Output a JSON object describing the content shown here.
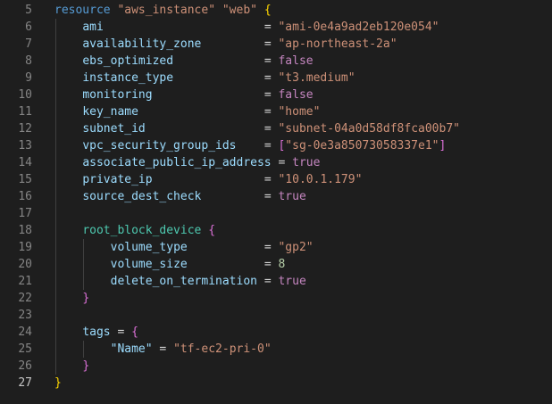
{
  "editor": {
    "lines": [
      {
        "n": "5",
        "indent": 0,
        "parts": [
          [
            "kw",
            "resource"
          ],
          [
            "punc",
            " "
          ],
          [
            "str",
            "\"aws_instance\""
          ],
          [
            "punc",
            " "
          ],
          [
            "str",
            "\"web\""
          ],
          [
            "punc",
            " "
          ],
          [
            "brace-y",
            "{"
          ]
        ]
      },
      {
        "n": "6",
        "indent": 1,
        "parts": [
          [
            "attr",
            "ami"
          ],
          [
            "pad",
            23
          ],
          [
            "eq",
            "= "
          ],
          [
            "str",
            "\"ami-0e4a9ad2eb120e054\""
          ]
        ]
      },
      {
        "n": "7",
        "indent": 1,
        "parts": [
          [
            "attr",
            "availability_zone"
          ],
          [
            "pad",
            9
          ],
          [
            "eq",
            "= "
          ],
          [
            "str",
            "\"ap-northeast-2a\""
          ]
        ]
      },
      {
        "n": "8",
        "indent": 1,
        "parts": [
          [
            "attr",
            "ebs_optimized"
          ],
          [
            "pad",
            13
          ],
          [
            "eq",
            "= "
          ],
          [
            "bool",
            "false"
          ]
        ]
      },
      {
        "n": "9",
        "indent": 1,
        "parts": [
          [
            "attr",
            "instance_type"
          ],
          [
            "pad",
            13
          ],
          [
            "eq",
            "= "
          ],
          [
            "str",
            "\"t3.medium\""
          ]
        ]
      },
      {
        "n": "10",
        "indent": 1,
        "parts": [
          [
            "attr",
            "monitoring"
          ],
          [
            "pad",
            16
          ],
          [
            "eq",
            "= "
          ],
          [
            "bool",
            "false"
          ]
        ]
      },
      {
        "n": "11",
        "indent": 1,
        "parts": [
          [
            "attr",
            "key_name"
          ],
          [
            "pad",
            18
          ],
          [
            "eq",
            "= "
          ],
          [
            "str",
            "\"home\""
          ]
        ]
      },
      {
        "n": "12",
        "indent": 1,
        "parts": [
          [
            "attr",
            "subnet_id"
          ],
          [
            "pad",
            17
          ],
          [
            "eq",
            "= "
          ],
          [
            "str",
            "\"subnet-04a0d58df8fca00b7\""
          ]
        ]
      },
      {
        "n": "13",
        "indent": 1,
        "parts": [
          [
            "attr",
            "vpc_security_group_ids"
          ],
          [
            "pad",
            4
          ],
          [
            "eq",
            "= "
          ],
          [
            "brace-p",
            "["
          ],
          [
            "str",
            "\"sg-0e3a85073058337e1\""
          ],
          [
            "brace-p",
            "]"
          ]
        ]
      },
      {
        "n": "14",
        "indent": 1,
        "parts": [
          [
            "attr",
            "associate_public_ip_address"
          ],
          [
            "pad",
            0
          ],
          [
            "eq",
            " = "
          ],
          [
            "bool",
            "true"
          ]
        ]
      },
      {
        "n": "15",
        "indent": 1,
        "parts": [
          [
            "attr",
            "private_ip"
          ],
          [
            "pad",
            16
          ],
          [
            "eq",
            "= "
          ],
          [
            "str",
            "\"10.0.1.179\""
          ]
        ]
      },
      {
        "n": "16",
        "indent": 1,
        "parts": [
          [
            "attr",
            "source_dest_check"
          ],
          [
            "pad",
            9
          ],
          [
            "eq",
            "= "
          ],
          [
            "bool",
            "true"
          ]
        ]
      },
      {
        "n": "17",
        "indent": 1,
        "parts": []
      },
      {
        "n": "18",
        "indent": 1,
        "parts": [
          [
            "blk",
            "root_block_device"
          ],
          [
            "punc",
            " "
          ],
          [
            "brace-p",
            "{"
          ]
        ]
      },
      {
        "n": "19",
        "indent": 2,
        "parts": [
          [
            "attr",
            "volume_type"
          ],
          [
            "pad",
            11
          ],
          [
            "eq",
            "= "
          ],
          [
            "str",
            "\"gp2\""
          ]
        ]
      },
      {
        "n": "20",
        "indent": 2,
        "parts": [
          [
            "attr",
            "volume_size"
          ],
          [
            "pad",
            11
          ],
          [
            "eq",
            "= "
          ],
          [
            "num",
            "8"
          ]
        ]
      },
      {
        "n": "21",
        "indent": 2,
        "parts": [
          [
            "attr",
            "delete_on_termination"
          ],
          [
            "pad",
            0
          ],
          [
            "eq",
            " = "
          ],
          [
            "bool",
            "true"
          ]
        ]
      },
      {
        "n": "22",
        "indent": 1,
        "parts": [
          [
            "brace-p",
            "}"
          ]
        ]
      },
      {
        "n": "23",
        "indent": 1,
        "parts": []
      },
      {
        "n": "24",
        "indent": 1,
        "parts": [
          [
            "attr",
            "tags"
          ],
          [
            "punc",
            " = "
          ],
          [
            "brace-p",
            "{"
          ]
        ]
      },
      {
        "n": "25",
        "indent": 2,
        "parts": [
          [
            "attr",
            "\"Name\""
          ],
          [
            "punc",
            " = "
          ],
          [
            "str",
            "\"tf-ec2-pri-0\""
          ]
        ]
      },
      {
        "n": "26",
        "indent": 1,
        "parts": [
          [
            "brace-p",
            "}"
          ]
        ]
      },
      {
        "n": "27",
        "indent": 0,
        "parts": [
          [
            "brace-y",
            "}"
          ]
        ],
        "active": true
      }
    ]
  },
  "colors": {
    "background": "#1e1e1e",
    "keyword": "#569cd6",
    "string": "#ce9178",
    "attribute": "#9cdcfe",
    "block": "#4ec9b0",
    "bool": "#c586c0",
    "number": "#b5cea8"
  }
}
